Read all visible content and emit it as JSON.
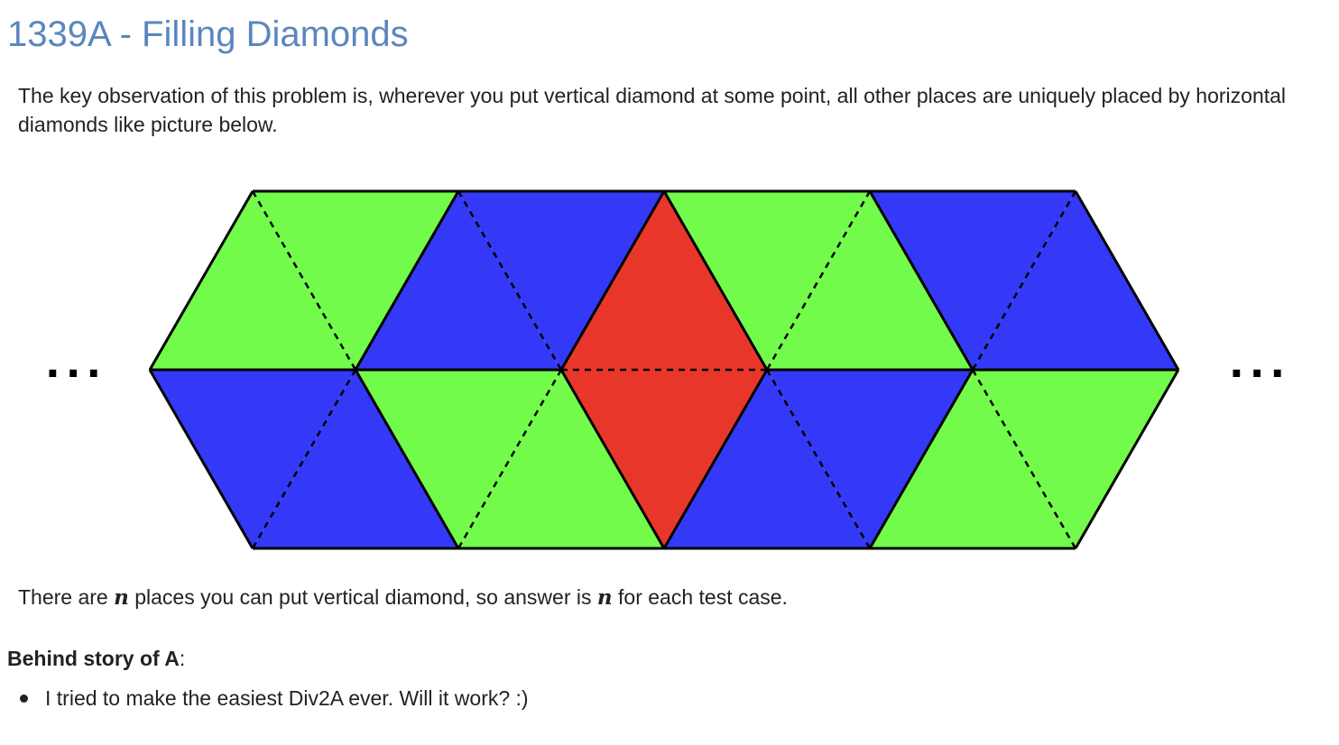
{
  "title": "1339A - Filling Diamonds",
  "intro": "The key observation of this problem is, wherever you put vertical diamond at some point, all other places are uniquely placed by horizontal diamonds like picture below.",
  "figure": {
    "ellipsis_left": "...",
    "ellipsis_right": "...",
    "colors": {
      "green": "#72fb4a",
      "blue": "#3439f7",
      "red": "#e8372a"
    }
  },
  "answer": {
    "part1": "There are ",
    "var1": "n",
    "part2": " places you can put vertical diamond, so answer is ",
    "var2": "n",
    "part3": " for each test case."
  },
  "story": {
    "heading": "Behind story of A",
    "colon": ":",
    "items": [
      "I tried to make the easiest Div2A ever. Will it work? :)"
    ]
  }
}
